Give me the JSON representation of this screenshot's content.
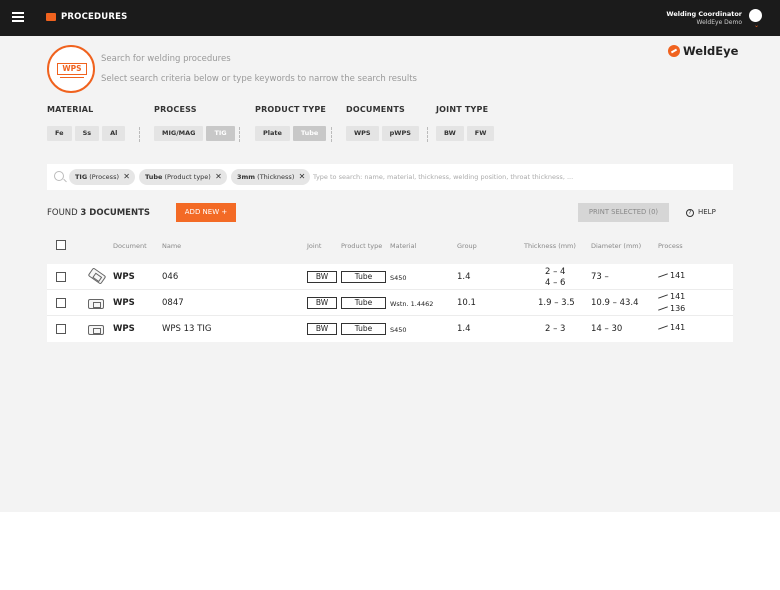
{
  "header": {
    "app_title": "PROCEDURES",
    "user_role": "Welding Coordinator",
    "user_org": "WeldEye Demo"
  },
  "hero": {
    "badge": "WPS",
    "title": "Search for welding procedures",
    "subtitle": "Select search criteria below or type keywords to narrow the search results",
    "logo_text": "WeldEye"
  },
  "filters": {
    "material": {
      "label": "MATERIAL",
      "options": [
        "Fe",
        "Ss",
        "Al"
      ]
    },
    "process": {
      "label": "PROCESS",
      "options": [
        "MIG/MAG",
        "TIG"
      ],
      "selected": "TIG"
    },
    "product_type": {
      "label": "PRODUCT TYPE",
      "options": [
        "Plate",
        "Tube"
      ],
      "selected": "Tube"
    },
    "documents": {
      "label": "DOCUMENTS",
      "options": [
        "WPS",
        "pWPS"
      ]
    },
    "joint_type": {
      "label": "JOINT TYPE",
      "options": [
        "BW",
        "FW"
      ]
    }
  },
  "search": {
    "tags": [
      {
        "value": "TIG",
        "category": "(Process)"
      },
      {
        "value": "Tube",
        "category": "(Product type)"
      },
      {
        "value": "3mm",
        "category": "(Thickness)"
      }
    ],
    "placeholder": "Type to search: name, material, thickness, welding position, throat thickness, ..."
  },
  "results": {
    "found_prefix": "FOUND",
    "found_count": "3 DOCUMENTS",
    "add_new_label": "ADD NEW +",
    "print_label": "PRINT SELECTED (0)",
    "help_label": "HELP"
  },
  "table": {
    "columns": {
      "document": "Document",
      "name": "Name",
      "joint": "Joint",
      "product_type": "Product type",
      "material": "Material",
      "group": "Group",
      "thickness": "Thickness (mm)",
      "diameter": "Diameter (mm)",
      "process": "Process"
    },
    "rows": [
      {
        "document": "WPS",
        "name": "046",
        "joint": "BW",
        "product_type": "Tube",
        "material": "S450",
        "group": "1.4",
        "thickness_1": "2 – 4",
        "thickness_2": "4 – 6",
        "diameter": "73 –",
        "process_1": "141",
        "process_2": ""
      },
      {
        "document": "WPS",
        "name": "0847",
        "joint": "BW",
        "product_type": "Tube",
        "material": "Wstn. 1.4462",
        "group": "10.1",
        "thickness_1": "1.9 – 3.5",
        "thickness_2": "",
        "diameter": "10.9 – 43.4",
        "process_1": "141",
        "process_2": "136"
      },
      {
        "document": "WPS",
        "name": "WPS 13 TIG",
        "joint": "BW",
        "product_type": "Tube",
        "material": "S450",
        "group": "1.4",
        "thickness_1": "2 – 3",
        "thickness_2": "",
        "diameter": "14 – 30",
        "process_1": "141",
        "process_2": ""
      }
    ]
  },
  "colors": {
    "accent": "#f36a25",
    "topbar": "#1b1b1b",
    "background": "#f3f3f3"
  }
}
